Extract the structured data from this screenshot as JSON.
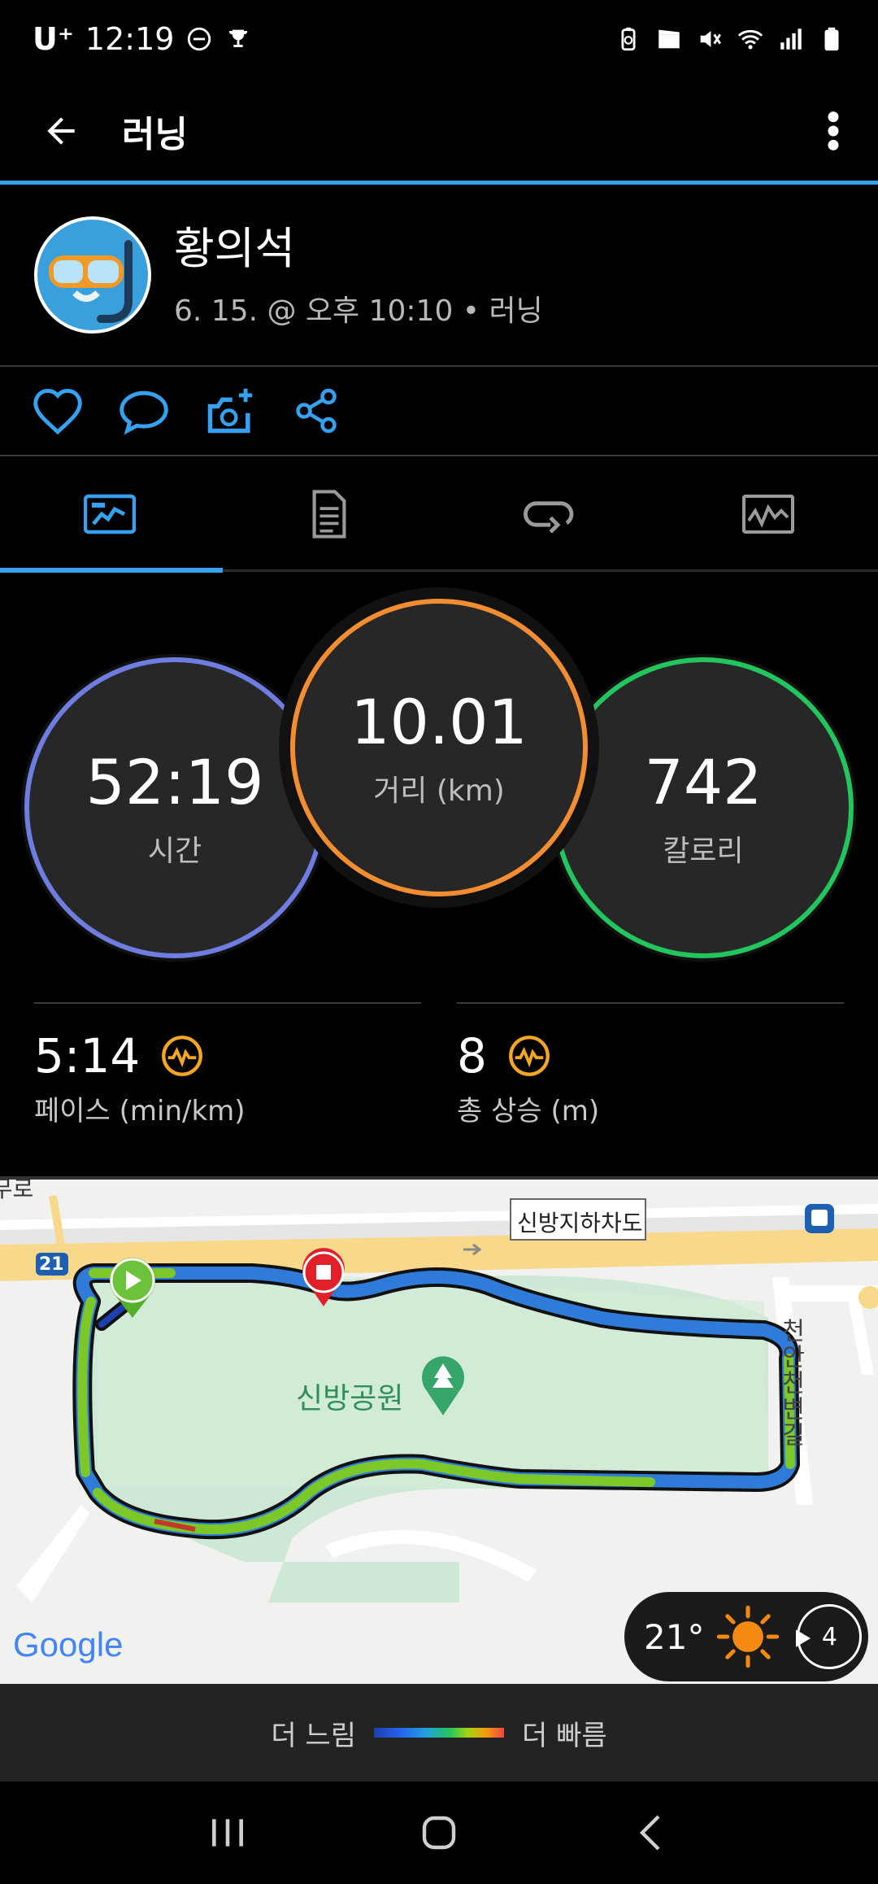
{
  "status_bar": {
    "carrier": "U⁺",
    "time": "12:19"
  },
  "app_bar": {
    "title": "러닝"
  },
  "profile": {
    "name": "황의석",
    "meta": "6. 15. @ 오후 10:10 • 러닝"
  },
  "summary": {
    "time": {
      "value": "52:19",
      "label": "시간"
    },
    "distance": {
      "value": "10.01",
      "label": "거리 (km)"
    },
    "calories": {
      "value": "742",
      "label": "칼로리"
    }
  },
  "stats": {
    "pace": {
      "value": "5:14",
      "label": "페이스 (min/km)"
    },
    "elevation": {
      "value": "8",
      "label": "총 상승 (m)"
    }
  },
  "map": {
    "labels": {
      "underpass": "신방지하차도",
      "park": "신방공원",
      "road_right": "천안천변길",
      "road_top_left": "충무로",
      "route_number": "21",
      "google": "Google"
    }
  },
  "weather": {
    "temperature": "21°",
    "wind": "4"
  },
  "legend": {
    "slower": "더 느림",
    "faster": "더 빠름"
  },
  "colors": {
    "accent": "#34a2ef",
    "time_ring": "#6f7de0",
    "distance_ring": "#f28d32",
    "calories_ring": "#22c55e"
  }
}
